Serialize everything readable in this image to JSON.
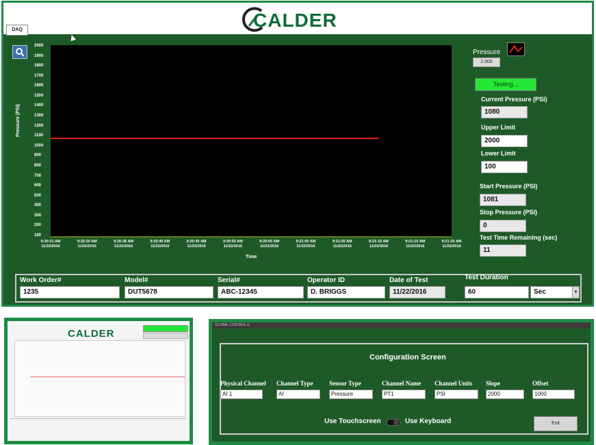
{
  "main": {
    "logo_text": "CALDER",
    "tab_label": "DAQ",
    "legend_label": "Pressure",
    "legend_box_label": "2.000",
    "status_text": "Testing...",
    "fields": {
      "current_pressure": {
        "label": "Current Pressure (PSI)",
        "value": "1080"
      },
      "upper_limit": {
        "label": "Upper Limit",
        "value": "2000"
      },
      "lower_limit": {
        "label": "Lower Limit",
        "value": "100"
      },
      "start_pressure": {
        "label": "Start Pressure (PSI)",
        "value": "1081"
      },
      "stop_pressure": {
        "label": "Stop Pressure (PSI)",
        "value": "0"
      },
      "time_remaining": {
        "label": "Test Time Remaining (sec)",
        "value": "11"
      }
    },
    "bottom": {
      "work_order": {
        "label": "Work Order#",
        "value": "1235"
      },
      "model": {
        "label": "Model#",
        "value": "DUT5678"
      },
      "serial": {
        "label": "Serial#",
        "value": "ABC-12345"
      },
      "operator": {
        "label": "Operator ID",
        "value": "D. BRIGGS"
      },
      "date": {
        "label": "Date of Test",
        "value": "11/22/2016"
      },
      "duration": {
        "label": "Test Duration",
        "value": "60",
        "unit": "Sec"
      }
    }
  },
  "chart_data": {
    "type": "line",
    "xlabel": "Time",
    "ylabel": "Pressure (PSI)",
    "ylim": [
      100,
      2000
    ],
    "yticks": [
      "2000",
      "1900",
      "1800",
      "1700",
      "1600",
      "1500",
      "1400",
      "1300",
      "1200",
      "1100",
      "1000",
      "900",
      "800",
      "700",
      "600",
      "500",
      "400",
      "300",
      "200",
      "100"
    ],
    "xticks": [
      [
        "9:20:21 AM",
        "11/22/2016"
      ],
      [
        "9:20:30 AM",
        "11/22/2016"
      ],
      [
        "9:20:35 AM",
        "11/22/2016"
      ],
      [
        "9:20:40 AM",
        "11/22/2016"
      ],
      [
        "9:20:45 AM",
        "11/22/2016"
      ],
      [
        "9:20:50 AM",
        "11/22/2016"
      ],
      [
        "9:20:55 AM",
        "11/22/2016"
      ],
      [
        "9:21:00 AM",
        "11/22/2016"
      ],
      [
        "9:21:05 AM",
        "11/22/2016"
      ],
      [
        "9:21:10 AM",
        "11/22/2016"
      ],
      [
        "9:21:15 AM",
        "11/22/2016"
      ],
      [
        "9:21:20 AM",
        "11/22/2016"
      ]
    ],
    "series": [
      {
        "color": "#e0201c",
        "x_start": "9:20:21 AM",
        "x_end": "9:21:10 AM",
        "value": 1080
      }
    ],
    "grid": false
  },
  "thumb1": {
    "logo_text": "CALDER"
  },
  "config": {
    "title_bar": "GLOBAL CONTROL.vi",
    "title": "Configuration Screen",
    "columns": [
      {
        "label": "Physical Channel",
        "value": "AI 1"
      },
      {
        "label": "Channel Type",
        "value": "AI"
      },
      {
        "label": "Sensor Type",
        "value": "Pressure"
      },
      {
        "label": "Channel Name",
        "value": "PT1"
      },
      {
        "label": "Channel Units",
        "value": "PSI"
      },
      {
        "label": "Slope",
        "value": "2000"
      },
      {
        "label": "Offset",
        "value": "1000"
      }
    ],
    "toggle_left": "Use Touchscreen",
    "toggle_right": "Use Keyboard",
    "exit_label": "Exit"
  },
  "colors": {
    "panel_green": "#1e5a28",
    "border_green": "#1f8a45",
    "trace_red": "#e0201c",
    "status_green": "#22e835"
  }
}
